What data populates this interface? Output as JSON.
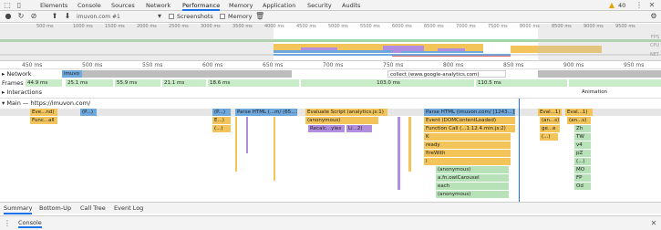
{
  "tabs": [
    "Elements",
    "Console",
    "Sources",
    "Network",
    "Performance",
    "Memory",
    "Application",
    "Security",
    "Audits"
  ],
  "active_tab": "Performance",
  "warnings": "40",
  "toolbar": {
    "profile_select": "imuvon.com #1",
    "screenshots_label": "Screenshots",
    "memory_label": "Memory"
  },
  "overview": {
    "ticks": [
      "500 ms",
      "1000 ms",
      "1500 ms",
      "2000 ms",
      "2500 ms",
      "3000 ms",
      "3500 ms",
      "4000 ms",
      "4500 ms",
      "5000 ms",
      "5500 ms",
      "6000 ms",
      "6500 ms",
      "7000 ms",
      "7500 ms",
      "8000 ms",
      "8500 ms",
      "9000 ms",
      "9500 ms"
    ],
    "labels": [
      "FPS",
      "CPU",
      "NET"
    ]
  },
  "ruler": [
    "450 ms",
    "500 ms",
    "550 ms",
    "600 ms",
    "650 ms",
    "700 ms",
    "750 ms",
    "800 ms",
    "850 ms",
    "900 ms",
    "950 ms"
  ],
  "network": {
    "label": "Network",
    "items": [
      "imuvo",
      "collect (www.google-analytics.com)"
    ]
  },
  "frames": {
    "label": "Frames",
    "items": [
      "44.9 ms",
      "25.1 ms",
      "55.9 ms",
      "21.1 ms",
      "18.6 ms",
      "103.0 ms",
      "110.5 ms"
    ]
  },
  "interactions": {
    "label": "Interactions",
    "animation": "Animation"
  },
  "main": {
    "label": "Main — https://imuvon.com/",
    "rows": [
      [
        "Eve...nd)",
        "(P...)",
        "(P...)",
        "Parse HTML (...m/ (65...393])",
        "Evaluate Script (analytics.js:1)",
        "Parse HTML (imuvon.com/ [1243...])",
        "Eval...1)",
        "Eval...1)"
      ],
      [
        "Func...all",
        "E...)",
        "(anonymous)",
        "Event (DOMContentLoaded)",
        "(an...s)",
        "(an...s)"
      ],
      [
        "(...)",
        "Recalc...yles",
        "Li...2)",
        "Function Call (...1.12.4.min.js:2)",
        "ge...e",
        "Zh"
      ],
      [
        "K",
        "(...)",
        "TW"
      ],
      [
        "ready",
        "v4"
      ],
      [
        "fireWith",
        "pZ"
      ],
      [
        "i",
        "(...)"
      ],
      [
        "(anonymous)",
        "MO"
      ],
      [
        "a.fn.owlCarousel",
        "FP"
      ],
      [
        "each",
        "Od"
      ],
      [
        "(anonymous)"
      ]
    ]
  },
  "bottom_tabs": [
    "Summary",
    "Bottom-Up",
    "Call Tree",
    "Event Log"
  ],
  "drawer_tab": "Console",
  "colors": {
    "scripting": "#f2c45a",
    "rendering": "#b28ee0",
    "painting": "#7fc97f",
    "loading": "#6fa8dc",
    "frames": "#c8ebc8",
    "accent": "#1a73e8"
  }
}
